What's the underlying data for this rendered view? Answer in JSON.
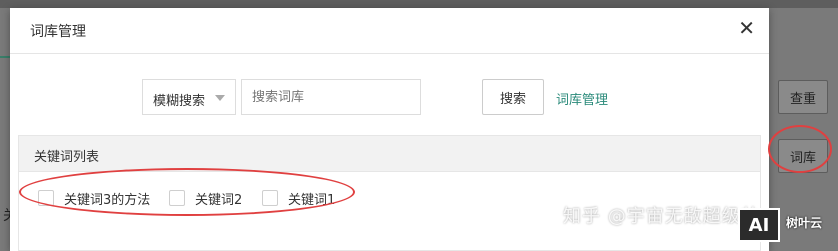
{
  "background": {
    "check_button_label": "查重",
    "library_button_label": "词库",
    "left_char": "关"
  },
  "modal": {
    "title": "词库管理",
    "close_symbol": "✕",
    "search": {
      "mode_label": "模糊搜索",
      "input_placeholder": "搜索词库",
      "input_value": "",
      "search_button": "搜索",
      "library_link": "词库管理"
    },
    "keyword_panel": {
      "title": "关键词列表",
      "items": [
        {
          "label": "关键词3的方法",
          "checked": false
        },
        {
          "label": "关键词2",
          "checked": false
        },
        {
          "label": "关键词1",
          "checked": false
        }
      ]
    }
  },
  "overlay": {
    "watermark": "知乎 @宇宙无敌超级帅",
    "badge": "AI",
    "badge_sub": "树叶云"
  },
  "colors": {
    "link": "#2a8a7a",
    "annotation_circle": "#e04040"
  }
}
